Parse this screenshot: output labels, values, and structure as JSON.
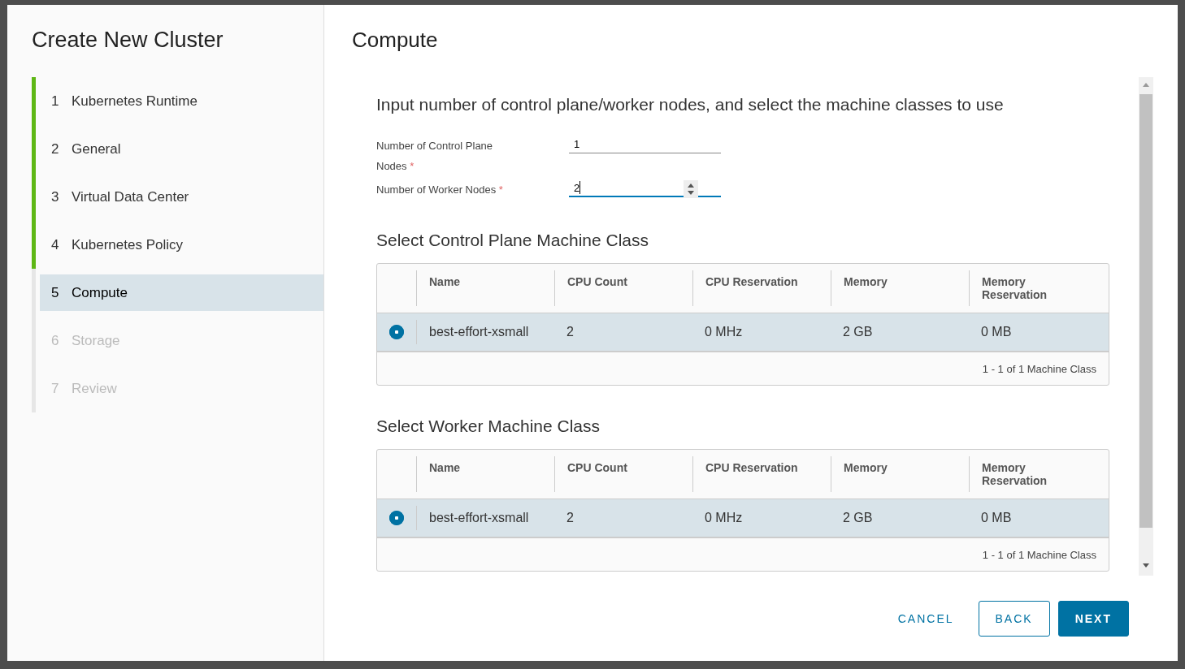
{
  "wizard": {
    "title": "Create New Cluster",
    "steps": [
      {
        "number": "1",
        "label": "Kubernetes Runtime",
        "completed": true,
        "selected": false,
        "disabled": false
      },
      {
        "number": "2",
        "label": "General",
        "completed": true,
        "selected": false,
        "disabled": false
      },
      {
        "number": "3",
        "label": "Virtual Data Center",
        "completed": true,
        "selected": false,
        "disabled": false
      },
      {
        "number": "4",
        "label": "Kubernetes Policy",
        "completed": true,
        "selected": false,
        "disabled": false
      },
      {
        "number": "5",
        "label": "Compute",
        "completed": false,
        "selected": true,
        "disabled": false
      },
      {
        "number": "6",
        "label": "Storage",
        "completed": false,
        "selected": false,
        "disabled": true
      },
      {
        "number": "7",
        "label": "Review",
        "completed": false,
        "selected": false,
        "disabled": true
      }
    ]
  },
  "page": {
    "title": "Compute",
    "intro": "Input number of control plane/worker nodes, and select the machine classes to use",
    "fields": [
      {
        "label": "Number of Control Plane Nodes",
        "required_mark": "*",
        "value": "1",
        "focused": false
      },
      {
        "label": "Number of Worker Nodes",
        "required_mark": "*",
        "value": "2",
        "focused": true
      }
    ],
    "tables": [
      {
        "title": "Select Control Plane Machine Class",
        "columns": [
          "Name",
          "CPU Count",
          "CPU Reservation",
          "Memory",
          "Memory Reservation"
        ],
        "rows": [
          {
            "selected": true,
            "cells": [
              "best-effort-xsmall",
              "2",
              "0 MHz",
              "2 GB",
              "0 MB"
            ]
          }
        ],
        "footer": "1 - 1 of 1 Machine Class"
      },
      {
        "title": "Select Worker Machine Class",
        "columns": [
          "Name",
          "CPU Count",
          "CPU Reservation",
          "Memory",
          "Memory Reservation"
        ],
        "rows": [
          {
            "selected": true,
            "cells": [
              "best-effort-xsmall",
              "2",
              "0 MHz",
              "2 GB",
              "0 MB"
            ]
          }
        ],
        "footer": "1 - 1 of 1 Machine Class"
      }
    ]
  },
  "buttons": [
    {
      "label": "CANCEL",
      "kind": "flat"
    },
    {
      "label": "BACK",
      "kind": "outline"
    },
    {
      "label": "NEXT",
      "kind": "primary"
    }
  ]
}
